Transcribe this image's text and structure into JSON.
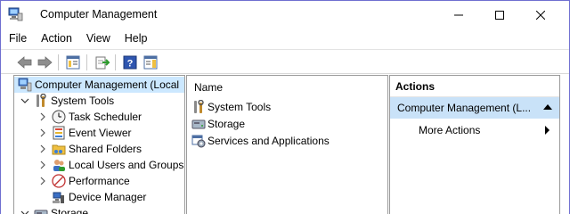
{
  "window": {
    "title": "Computer Management",
    "controls": {
      "minimize": "—",
      "maximize": "☐",
      "close": "✕"
    }
  },
  "menubar": {
    "items": [
      "File",
      "Action",
      "View",
      "Help"
    ]
  },
  "toolbar": {
    "buttons": [
      "back-arrow-icon",
      "forward-arrow-icon",
      "show-hide-tree-icon",
      "export-list-icon",
      "help-icon",
      "show-hide-action-pane-icon"
    ]
  },
  "tree": {
    "root": "Computer Management (Local",
    "system_tools": "System Tools",
    "items": [
      {
        "label": "Task Scheduler",
        "icon": "clock-icon"
      },
      {
        "label": "Event Viewer",
        "icon": "event-viewer-icon"
      },
      {
        "label": "Shared Folders",
        "icon": "shared-folder-icon"
      },
      {
        "label": "Local Users and Groups",
        "icon": "users-icon"
      },
      {
        "label": "Performance",
        "icon": "performance-icon"
      },
      {
        "label": "Device Manager",
        "icon": "device-manager-icon"
      }
    ],
    "storage": "Storage"
  },
  "center": {
    "column_header": "Name",
    "rows": [
      {
        "label": "System Tools",
        "icon": "tools-icon"
      },
      {
        "label": "Storage",
        "icon": "storage-icon"
      },
      {
        "label": "Services and Applications",
        "icon": "services-icon"
      }
    ]
  },
  "actions": {
    "header": "Actions",
    "group": "Computer Management (L...",
    "item": "More Actions"
  },
  "colors": {
    "selection": "#cce8ff",
    "action_group": "#c9e2f8",
    "border": "#9a9a9a"
  }
}
